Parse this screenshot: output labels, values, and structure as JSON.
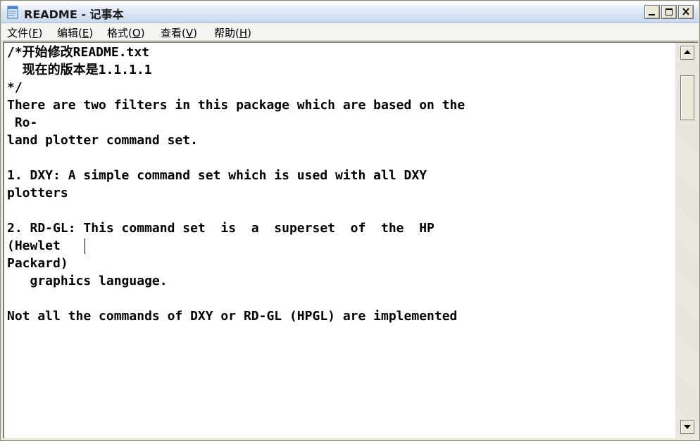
{
  "window": {
    "title": "README - 记事本",
    "app_icon": "notepad-icon",
    "controls": {
      "minimize_icon": "minimize-icon",
      "maximize_icon": "maximize-icon",
      "close_icon": "close-icon"
    }
  },
  "menu": [
    {
      "label": "文件",
      "accel": "F"
    },
    {
      "label": "编辑",
      "accel": "E"
    },
    {
      "label": "格式",
      "accel": "O"
    },
    {
      "label": "查看",
      "accel": "V"
    },
    {
      "label": "帮助",
      "accel": "H"
    }
  ],
  "document": {
    "lines": [
      "/*开始修改README.txt",
      "  现在的版本是1.1.1.1",
      "*/",
      "There are two filters in this package which are based on the",
      " Ro-",
      "land plotter command set.",
      "",
      "1. DXY: A simple command set which is used with all DXY",
      "plotters",
      "",
      "2. RD-GL: This command set  is  a  superset  of  the  HP",
      "(Hewlet",
      "Packard)",
      "   graphics language.",
      "",
      "Not all the commands of DXY or RD-GL (HPGL) are implemented"
    ]
  },
  "scrollbar": {
    "up_icon": "scroll-up-arrow-icon",
    "down_icon": "scroll-down-arrow-icon",
    "position_fraction": 0.0
  }
}
